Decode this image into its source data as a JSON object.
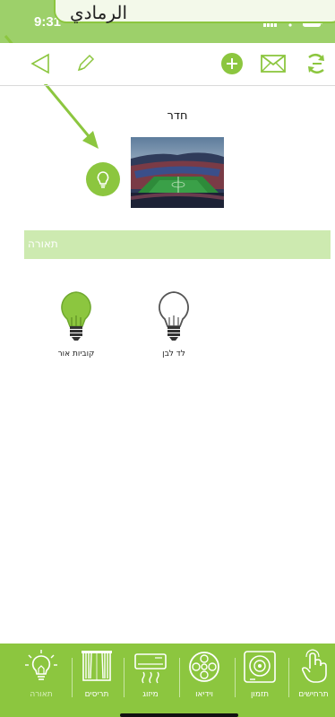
{
  "status_bar": {
    "time": "9:31"
  },
  "callout": {
    "text": "الرمادي"
  },
  "toolbar": {
    "back": "back-icon",
    "edit": "pencil-icon",
    "add": "plus-icon",
    "mail": "mail-icon",
    "switch": "switch-icon"
  },
  "room": {
    "title": "חדר"
  },
  "section": {
    "title": "תאורה"
  },
  "devices": [
    {
      "label": "קוביות אור",
      "state": "on"
    },
    {
      "label": "לד לבן",
      "state": "off"
    }
  ],
  "bottom_nav": {
    "items": [
      {
        "label": "תאורה",
        "icon": "bulb-icon",
        "active": true
      },
      {
        "label": "תריסים",
        "icon": "curtains-icon",
        "active": false
      },
      {
        "label": "מיזוג",
        "icon": "ac-icon",
        "active": false
      },
      {
        "label": "וידיאו",
        "icon": "film-reel-icon",
        "active": false
      },
      {
        "label": "תזמון",
        "icon": "timer-icon",
        "active": false
      },
      {
        "label": "תרחישים",
        "icon": "hand-touch-icon",
        "active": false
      }
    ]
  },
  "colors": {
    "accent": "#8cc63f",
    "section_bg": "#cdeab0",
    "status_bg": "#9dd06a"
  }
}
